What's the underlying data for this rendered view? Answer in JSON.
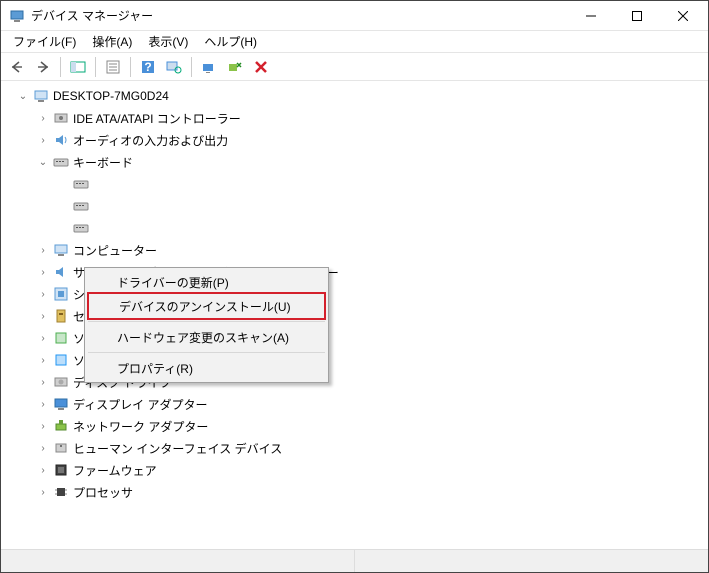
{
  "window": {
    "title": "デバイス マネージャー"
  },
  "menubar": [
    {
      "label": "ファイル(F)"
    },
    {
      "label": "操作(A)"
    },
    {
      "label": "表示(V)"
    },
    {
      "label": "ヘルプ(H)"
    }
  ],
  "tree": {
    "root": {
      "label": "DESKTOP-7MG0D24",
      "expanded": true
    },
    "items": [
      {
        "label": "IDE ATA/ATAPI コントローラー",
        "icon": "ide",
        "exp": "closed"
      },
      {
        "label": "オーディオの入力および出力",
        "icon": "audio",
        "exp": "closed"
      },
      {
        "label": "キーボード",
        "icon": "keyboard",
        "exp": "open"
      },
      {
        "label": "コンピューター",
        "icon": "computer",
        "exp": "closed"
      },
      {
        "label": "サウンド、ビデオ、およびゲーム コントローラー",
        "icon": "sound",
        "exp": "closed"
      },
      {
        "label": "システム デバイス",
        "icon": "system",
        "exp": "closed"
      },
      {
        "label": "セキュリティ デバイス",
        "icon": "security",
        "exp": "closed"
      },
      {
        "label": "ソフトウェア コンポーネント",
        "icon": "swcomp",
        "exp": "closed"
      },
      {
        "label": "ソフトウェア デバイス",
        "icon": "swdev",
        "exp": "closed"
      },
      {
        "label": "ディスク ドライブ",
        "icon": "disk",
        "exp": "closed"
      },
      {
        "label": "ディスプレイ アダプター",
        "icon": "display",
        "exp": "closed"
      },
      {
        "label": "ネットワーク アダプター",
        "icon": "network",
        "exp": "closed"
      },
      {
        "label": "ヒューマン インターフェイス デバイス",
        "icon": "hid",
        "exp": "closed"
      },
      {
        "label": "ファームウェア",
        "icon": "firmware",
        "exp": "closed"
      },
      {
        "label": "プロセッサ",
        "icon": "cpu",
        "exp": "closed"
      }
    ]
  },
  "ctx": {
    "update": "ドライバーの更新(P)",
    "uninstall": "デバイスのアンインストール(U)",
    "scan": "ハードウェア変更のスキャン(A)",
    "props": "プロパティ(R)"
  },
  "icons": {
    "computer": "🖥️",
    "ide": "💽",
    "audio": "🔊",
    "keyboard": "⌨️",
    "sound": "🔊",
    "system": "🖥️",
    "security": "🔒",
    "swcomp": "📦",
    "swdev": "🧩",
    "disk": "💽",
    "display": "🖥️",
    "network": "📡",
    "hid": "🖱️",
    "firmware": "🔲",
    "cpu": "🔲"
  }
}
